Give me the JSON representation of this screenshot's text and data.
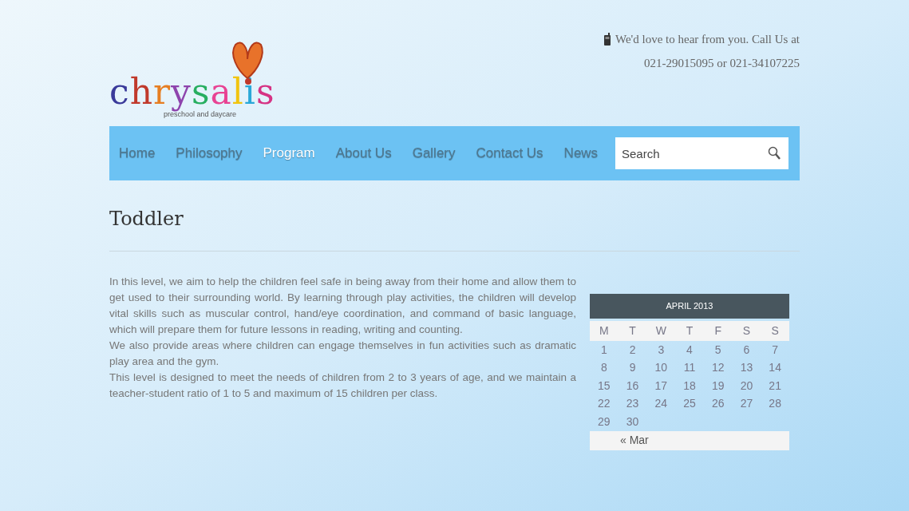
{
  "contact": {
    "line1": "We'd love to hear from you. Call Us at",
    "line2": "021-29015095 or 021-34107225"
  },
  "logo": {
    "name": "chrysalis",
    "tagline": "preschool and daycare"
  },
  "nav": {
    "items": [
      {
        "label": "Home",
        "selected": false
      },
      {
        "label": "Philosophy",
        "selected": false
      },
      {
        "label": "Program",
        "selected": true
      },
      {
        "label": "About Us",
        "selected": false
      },
      {
        "label": "Gallery",
        "selected": false
      },
      {
        "label": "Contact Us",
        "selected": false
      },
      {
        "label": "News",
        "selected": false
      }
    ],
    "search": {
      "placeholder": "Search"
    }
  },
  "page_title": "Toddler",
  "paragraphs": [
    "In this level, we aim to help the children feel safe in being away from their home and allow them to get used to their surrounding world. By learning through play activities, the children will develop vital skills such as muscular control, hand/eye coordination, and command of basic language, which will prepare them for future lessons in reading, writing and counting.",
    "We also provide areas where children can engage themselves in fun activities such as dramatic play area and the gym.",
    "This level is designed to meet the needs of children from  2 to 3 years of age, and we maintain a teacher-student ratio of 1 to 5 and maximum of 15 children per class."
  ],
  "calendar": {
    "title": "APRIL 2013",
    "weekdays": [
      "M",
      "T",
      "W",
      "T",
      "F",
      "S",
      "S"
    ],
    "weeks": [
      [
        "1",
        "2",
        "3",
        "4",
        "5",
        "6",
        "7"
      ],
      [
        "8",
        "9",
        "10",
        "11",
        "12",
        "13",
        "14"
      ],
      [
        "15",
        "16",
        "17",
        "18",
        "19",
        "20",
        "21"
      ],
      [
        "22",
        "23",
        "24",
        "25",
        "26",
        "27",
        "28"
      ],
      [
        "29",
        "30"
      ]
    ],
    "prev_link": "« Mar"
  }
}
